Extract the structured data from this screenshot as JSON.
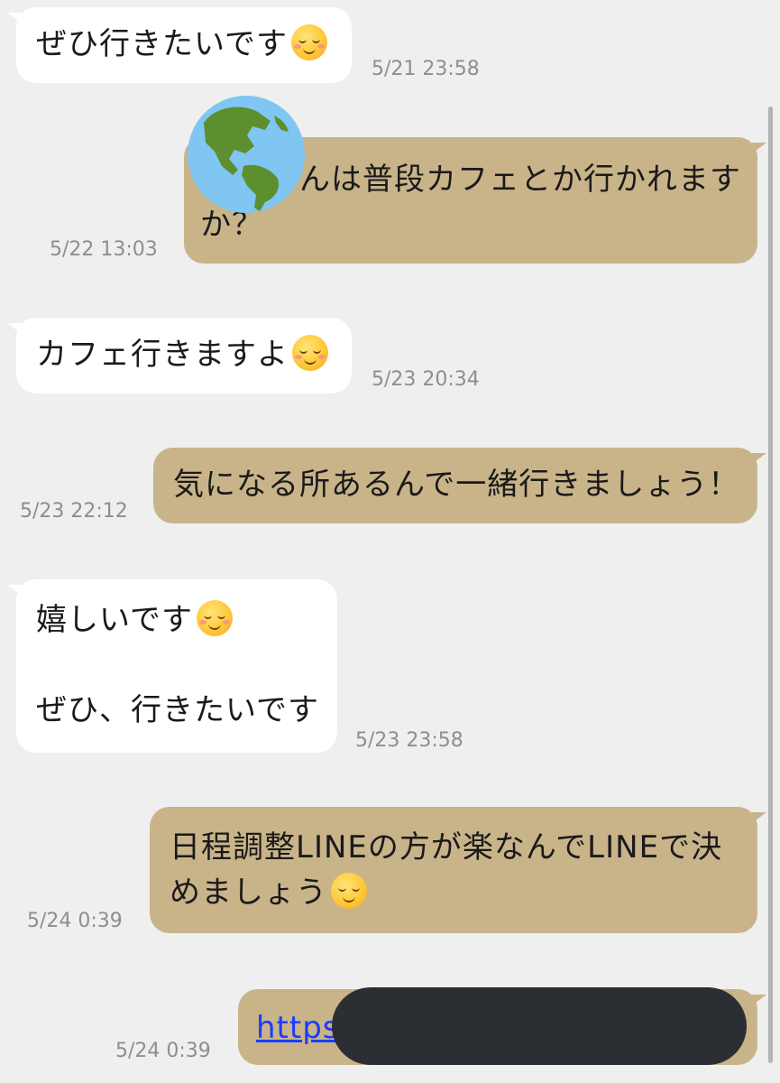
{
  "messages": [
    {
      "side": "received",
      "text": "ぜひ行きたいです",
      "emoji": "smiling-face-icon",
      "time": "5/21 23:58"
    },
    {
      "side": "sent",
      "line1": "んは普段カフェとか行かれます",
      "line2": "か？",
      "time": "5/22 13:03"
    },
    {
      "side": "received",
      "text": "カフェ行きますよ",
      "emoji": "smiling-face-icon",
      "time": "5/23 20:34"
    },
    {
      "side": "sent",
      "text": "気になる所あるんで一緒行きましょう！",
      "time": "5/23 22:12"
    },
    {
      "side": "received",
      "line1": "嬉しいです",
      "line2": "ぜひ、行きたいです",
      "emoji": "smiling-face-icon",
      "time": "5/23 23:58"
    },
    {
      "side": "sent",
      "line1": "日程調整LINEの方が楽なんでLINEで決",
      "line2": "めましょう",
      "emoji": "relieved-face-icon",
      "time": "5/24 0:39"
    },
    {
      "side": "sent",
      "text": "https",
      "time": "5/24 0:39"
    }
  ],
  "avatar": {
    "icon": "globe-americas-icon"
  },
  "colors": {
    "background": "#efefef",
    "received_bubble": "#ffffff",
    "sent_bubble": "#c9b48a",
    "timestamp": "#8e8e8e",
    "link": "#1a3cff",
    "redaction": "#2b2f33"
  }
}
